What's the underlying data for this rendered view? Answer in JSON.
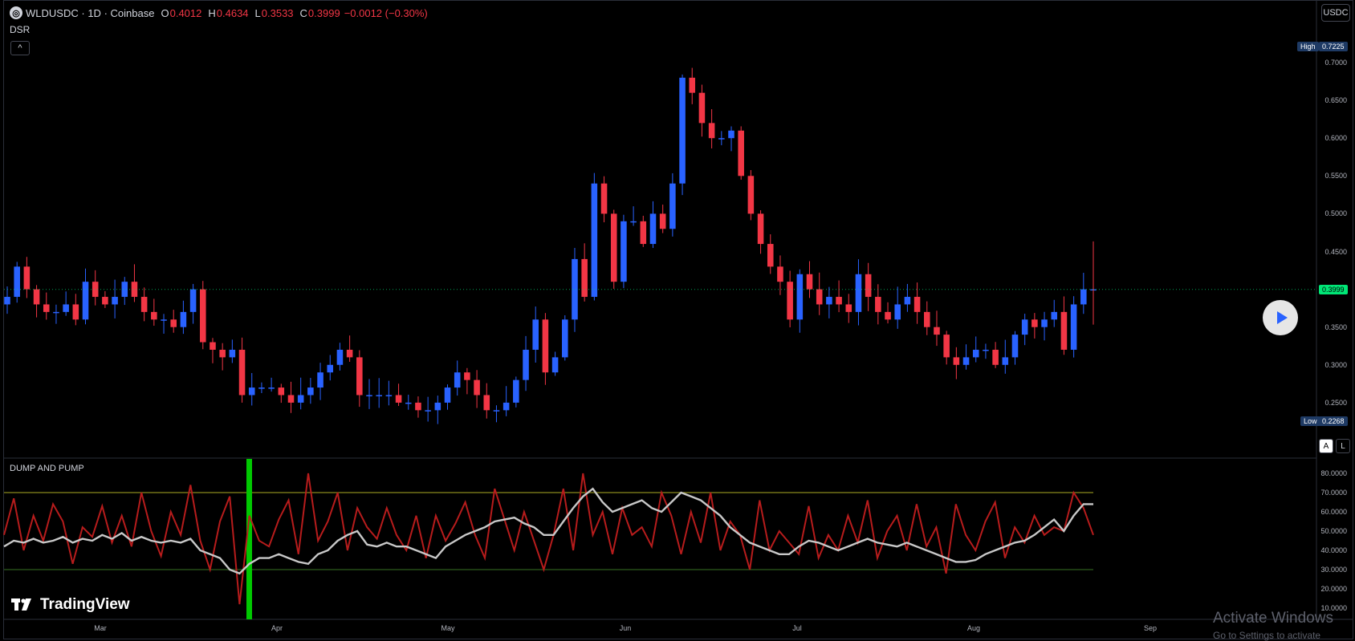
{
  "header": {
    "symbol": "WLDUSDC",
    "sep1": "·",
    "interval": "1D",
    "sep2": "·",
    "exchange": "Coinbase",
    "o_label": "O",
    "o_value": "0.4012",
    "h_label": "H",
    "h_value": "0.4634",
    "l_label": "L",
    "l_value": "0.3533",
    "c_label": "C",
    "c_value": "0.3999",
    "change": "−0.0012 (−0.30%)"
  },
  "indicator_main": "DSR",
  "collapse_icon": "chevron-up-icon",
  "collapse_glyph": "^",
  "currency_button": "USDC",
  "price_axis": {
    "labels": [
      "0.7000",
      "0.6500",
      "0.6000",
      "0.5500",
      "0.5000",
      "0.4500",
      "0.3500",
      "0.3000",
      "0.2500"
    ],
    "high_label": "High",
    "high_value": "0.7225",
    "low_label": "Low",
    "low_value": "0.2268",
    "last_value": "0.3999"
  },
  "buttons": {
    "auto": "A",
    "log": "L"
  },
  "indicator_pane": {
    "title": "DUMP AND PUMP",
    "axis_labels": [
      "80.0000",
      "70.0000",
      "60.0000",
      "50.0000",
      "40.0000",
      "30.0000",
      "20.0000",
      "10.0000"
    ]
  },
  "time_axis": [
    "Mar",
    "Apr",
    "May",
    "Jun",
    "Jul",
    "Aug",
    "Sep"
  ],
  "branding": {
    "logo_text": "TradingView"
  },
  "watermark": {
    "line1": "Activate Windows",
    "line2": "Go to Settings to activate"
  },
  "colors": {
    "up": "#2962ff",
    "down": "#f23645",
    "last_price": "#00e676",
    "rsi": "#b71c1c",
    "smooth": "#c8c8c8",
    "band_hi": "#8a8a1e",
    "band_lo": "#2e5e1e",
    "signal": "#00c800"
  },
  "chart_data": [
    {
      "type": "candlestick",
      "title": "WLDUSDC · 1D · Coinbase",
      "ylim": [
        0.21,
        0.75
      ],
      "x_labels": [
        "Mar",
        "Apr",
        "May",
        "Jun",
        "Jul",
        "Aug",
        "Sep"
      ],
      "close_series": [
        0.39,
        0.43,
        0.4,
        0.38,
        0.37,
        0.37,
        0.38,
        0.36,
        0.41,
        0.39,
        0.38,
        0.39,
        0.41,
        0.39,
        0.37,
        0.36,
        0.36,
        0.35,
        0.37,
        0.4,
        0.33,
        0.32,
        0.31,
        0.32,
        0.26,
        0.27,
        0.27,
        0.27,
        0.26,
        0.25,
        0.26,
        0.27,
        0.29,
        0.3,
        0.32,
        0.31,
        0.26,
        0.26,
        0.26,
        0.26,
        0.25,
        0.25,
        0.24,
        0.24,
        0.25,
        0.27,
        0.29,
        0.28,
        0.26,
        0.24,
        0.24,
        0.25,
        0.28,
        0.32,
        0.36,
        0.29,
        0.31,
        0.36,
        0.44,
        0.39,
        0.54,
        0.5,
        0.41,
        0.49,
        0.49,
        0.46,
        0.5,
        0.48,
        0.54,
        0.68,
        0.66,
        0.62,
        0.6,
        0.6,
        0.61,
        0.55,
        0.5,
        0.46,
        0.43,
        0.41,
        0.36,
        0.42,
        0.4,
        0.38,
        0.39,
        0.38,
        0.37,
        0.42,
        0.39,
        0.37,
        0.36,
        0.38,
        0.39,
        0.37,
        0.35,
        0.34,
        0.31,
        0.3,
        0.31,
        0.32,
        0.32,
        0.3,
        0.31,
        0.34,
        0.36,
        0.35,
        0.36,
        0.37,
        0.32,
        0.38,
        0.4,
        0.4
      ],
      "high": 0.7225,
      "low": 0.2268,
      "last": 0.3999
    },
    {
      "type": "line",
      "title": "DUMP AND PUMP",
      "ylim": [
        5,
        85
      ],
      "bands": [
        70,
        30
      ],
      "series": [
        {
          "values": [
            48,
            67,
            40,
            58,
            45,
            64,
            55,
            33,
            52,
            47,
            63,
            44,
            58,
            42,
            70,
            50,
            37,
            60,
            48,
            74,
            45,
            30,
            55,
            68,
            12,
            58,
            45,
            42,
            56,
            66,
            38,
            80,
            45,
            55,
            70,
            40,
            62,
            52,
            46,
            62,
            48,
            40,
            58,
            36,
            58,
            45,
            54,
            65,
            48,
            36,
            72,
            56,
            40,
            60,
            45,
            30,
            48,
            72,
            40,
            80,
            48,
            60,
            38,
            62,
            48,
            52,
            42,
            70,
            58,
            38,
            60,
            44,
            70,
            40,
            55,
            48,
            30,
            66,
            40,
            50,
            44,
            38,
            63,
            36,
            48,
            40,
            58,
            44,
            66,
            36,
            50,
            58,
            40,
            64,
            42,
            52,
            28,
            64,
            48,
            40,
            55,
            65,
            36,
            52,
            44,
            58,
            48,
            52,
            50,
            70,
            62,
            48
          ]
        },
        {
          "values": [
            42,
            45,
            44,
            46,
            44,
            45,
            47,
            44,
            46,
            45,
            48,
            46,
            49,
            45,
            47,
            45,
            44,
            45,
            44,
            46,
            40,
            38,
            36,
            30,
            28,
            33,
            36,
            36,
            38,
            36,
            34,
            33,
            38,
            40,
            45,
            48,
            50,
            43,
            42,
            44,
            42,
            42,
            40,
            38,
            36,
            42,
            45,
            48,
            50,
            52,
            55,
            56,
            57,
            54,
            52,
            48,
            48,
            55,
            62,
            68,
            72,
            65,
            60,
            62,
            64,
            66,
            62,
            60,
            65,
            70,
            68,
            66,
            62,
            58,
            52,
            48,
            44,
            42,
            40,
            38,
            38,
            42,
            45,
            44,
            42,
            40,
            42,
            44,
            46,
            44,
            43,
            42,
            44,
            42,
            40,
            38,
            36,
            34,
            34,
            35,
            38,
            40,
            42,
            44,
            45,
            48,
            52,
            56,
            50,
            58,
            64,
            64
          ]
        }
      ]
    }
  ]
}
